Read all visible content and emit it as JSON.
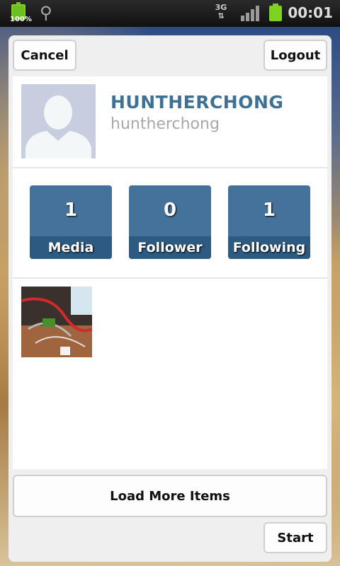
{
  "status_bar": {
    "battery_percent": "100%",
    "network_type": "3G",
    "time": "00:01"
  },
  "dialog": {
    "cancel_label": "Cancel",
    "logout_label": "Logout",
    "load_more_label": "Load More Items",
    "start_label": "Start"
  },
  "profile": {
    "display_name": "HUNTHERCHONG",
    "username": "huntherchong"
  },
  "stats": [
    {
      "count": "1",
      "label": "Media"
    },
    {
      "count": "0",
      "label": "Follower"
    },
    {
      "count": "1",
      "label": "Following"
    }
  ],
  "colors": {
    "name": "#3f7196",
    "stat_tile": "#44729a",
    "stat_label_bar": "#2c5a80"
  }
}
